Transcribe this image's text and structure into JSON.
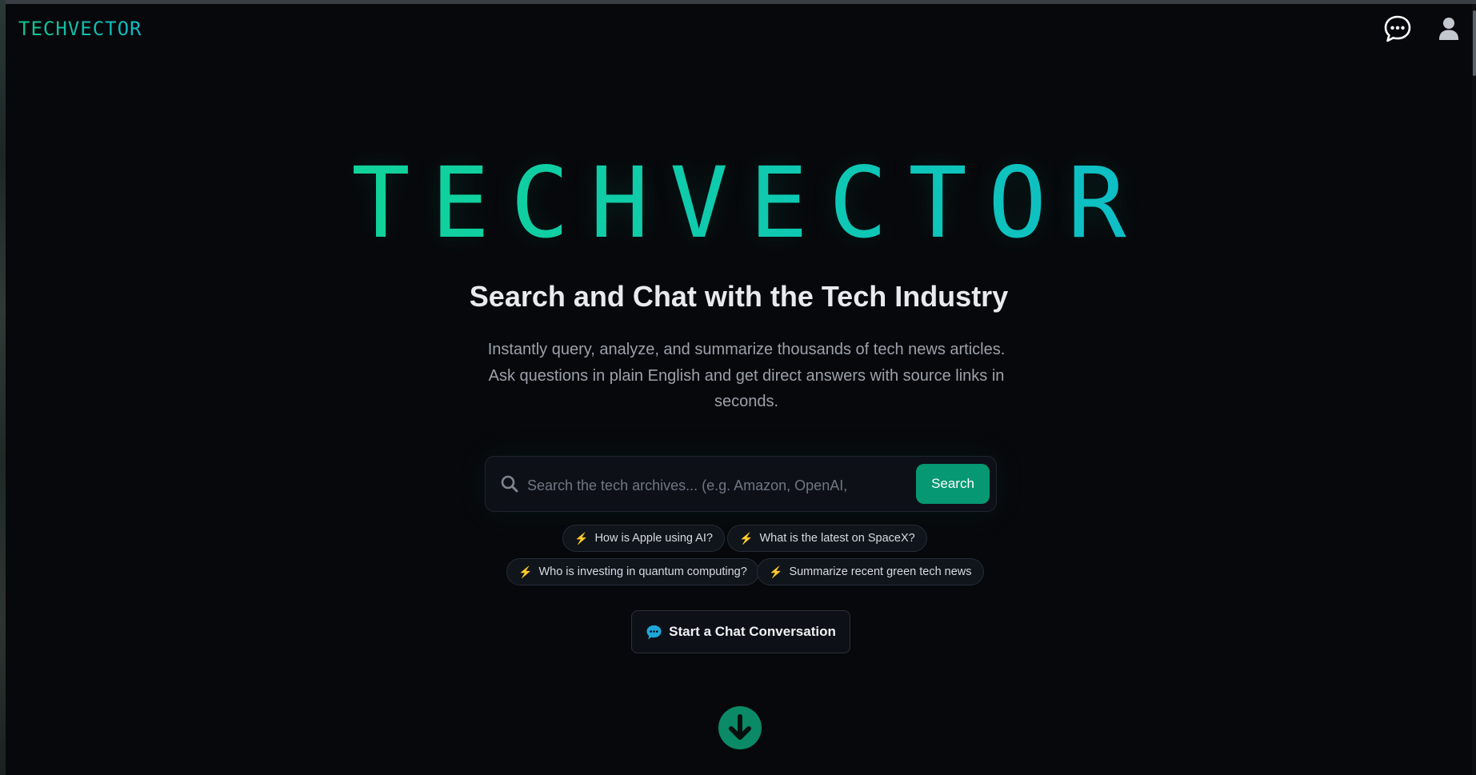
{
  "header": {
    "brand": "TECHVECTOR",
    "chat_icon": "chat-bubble-icon",
    "user_icon": "user-icon"
  },
  "hero": {
    "title": "TECHVECTOR",
    "subtitle": "Search and Chat with the Tech Industry",
    "description": "Instantly query, analyze, and summarize thousands of tech news articles. Ask questions in plain English and get direct answers with source links in seconds."
  },
  "search": {
    "placeholder": "Search the tech archives... (e.g. Amazon, OpenAI, robotics)",
    "value": "",
    "button_label": "Search",
    "icon": "search-icon"
  },
  "suggestions": [
    {
      "label": "How is Apple using AI?",
      "icon": "lightning-icon"
    },
    {
      "label": "What is the latest on SpaceX?",
      "icon": "lightning-icon"
    },
    {
      "label": "Who is investing in quantum computing?",
      "icon": "lightning-icon"
    },
    {
      "label": "Summarize recent green tech news",
      "icon": "lightning-icon"
    }
  ],
  "chat_cta": {
    "label": "Start a Chat Conversation",
    "icon": "chat-bubble-icon"
  },
  "scroll_down": {
    "icon": "arrow-down-icon"
  },
  "colors": {
    "background": "#07080b",
    "accent_green": "#12d39a",
    "accent_cyan": "#0fb7d6",
    "button_green": "#059872",
    "bolt_yellow": "#f5c518"
  }
}
